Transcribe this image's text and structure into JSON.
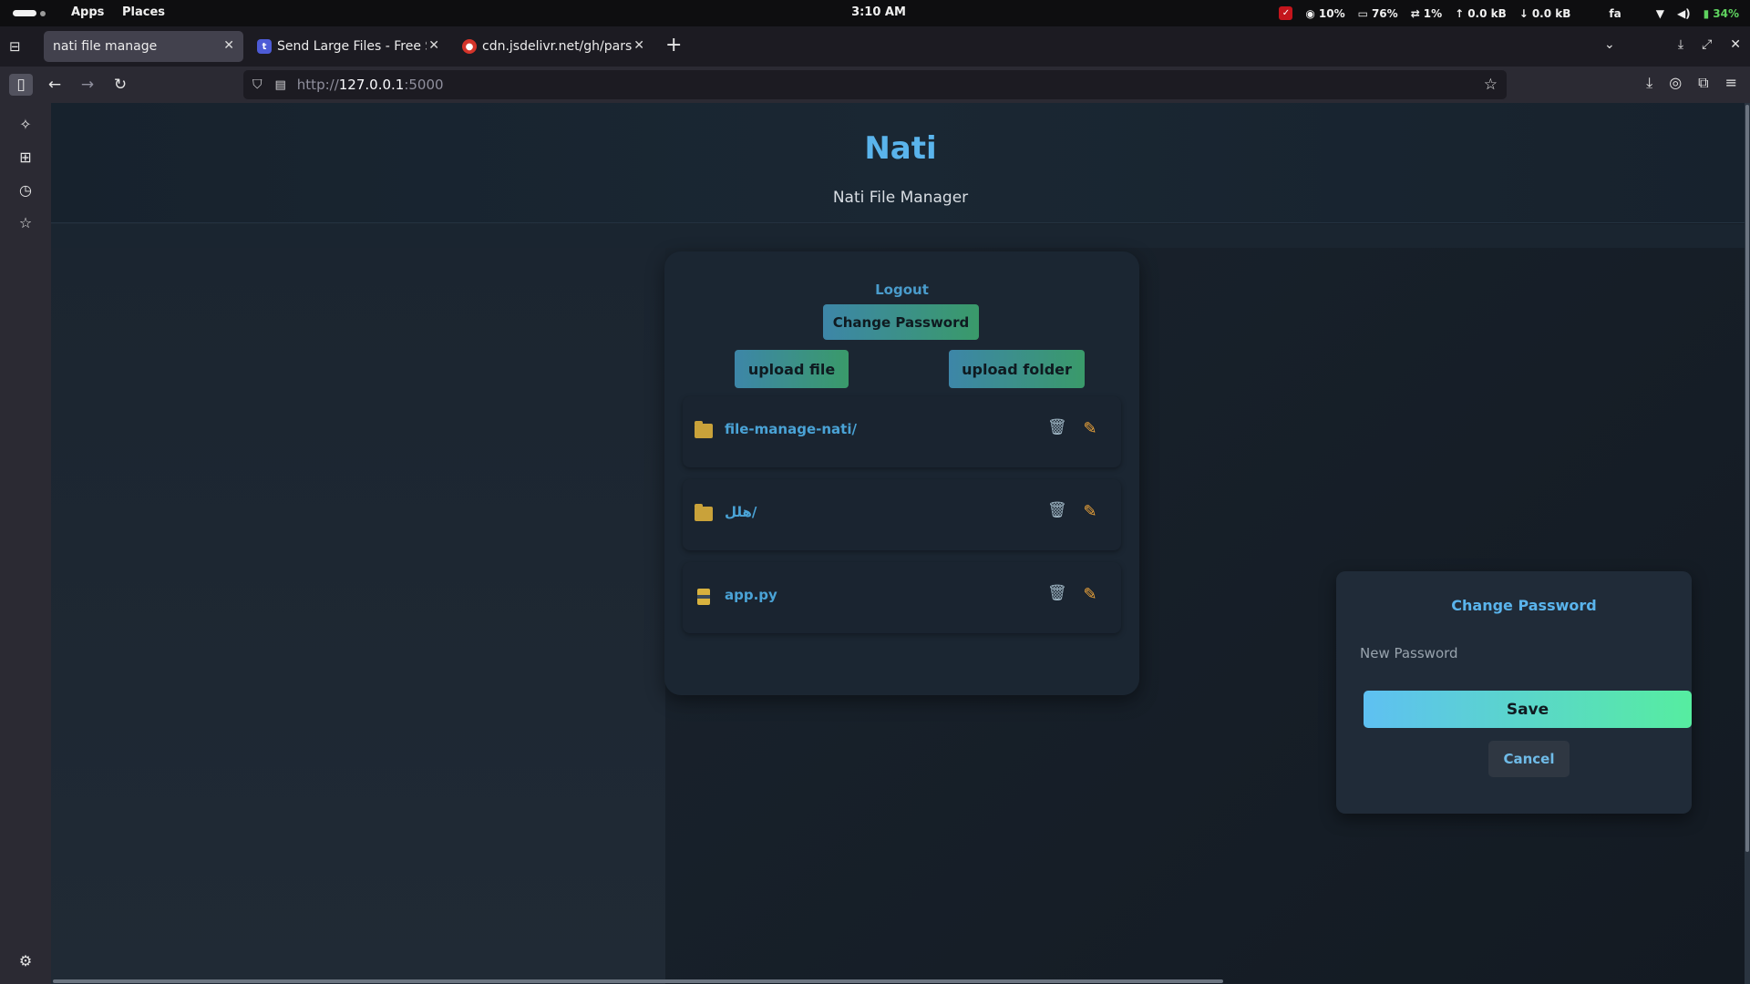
{
  "system_bar": {
    "menu_apps": "Apps",
    "menu_places": "Places",
    "clock": "3:10 AM",
    "cpu": "10%",
    "memory": "76%",
    "swap": "1%",
    "net_up": "0.0 kB",
    "net_down": "0.0 kB",
    "keyboard_layout": "fa",
    "battery": "34%"
  },
  "browser": {
    "tabs": [
      {
        "title": "nati file manage",
        "active": true
      },
      {
        "title": "Send Large Files - Free Se",
        "active": false
      },
      {
        "title": "cdn.jsdelivr.net/gh/parsin",
        "active": false
      }
    ],
    "url_prefix": "http://",
    "url_host": "127.0.0.1",
    "url_suffix": ":5000"
  },
  "page": {
    "title": "Nati",
    "subtitle": "Nati File Manager",
    "logout_label": "Logout",
    "change_password_label": "Change Password",
    "upload_file_label": "upload file",
    "upload_folder_label": "upload folder",
    "files": [
      {
        "name": "file-manage-nati/",
        "kind": "folder"
      },
      {
        "name": "هلل/",
        "kind": "folder"
      },
      {
        "name": "app.py",
        "kind": "file"
      }
    ]
  },
  "dialog": {
    "title": "Change Password",
    "new_password_placeholder": "New Password",
    "save_label": "Save",
    "cancel_label": "Cancel"
  },
  "colors": {
    "accent_blue": "#5ab4ec",
    "button_gradient_start": "#3d86a8",
    "button_gradient_end": "#3a9a6a",
    "save_gradient_start": "#5ec0f2",
    "save_gradient_end": "#56eda0",
    "folder_icon": "#c9a23a"
  },
  "icons": {
    "trash": "trash-icon",
    "edit": "pencil-icon",
    "folder": "folder-icon",
    "file": "python-file-icon"
  }
}
